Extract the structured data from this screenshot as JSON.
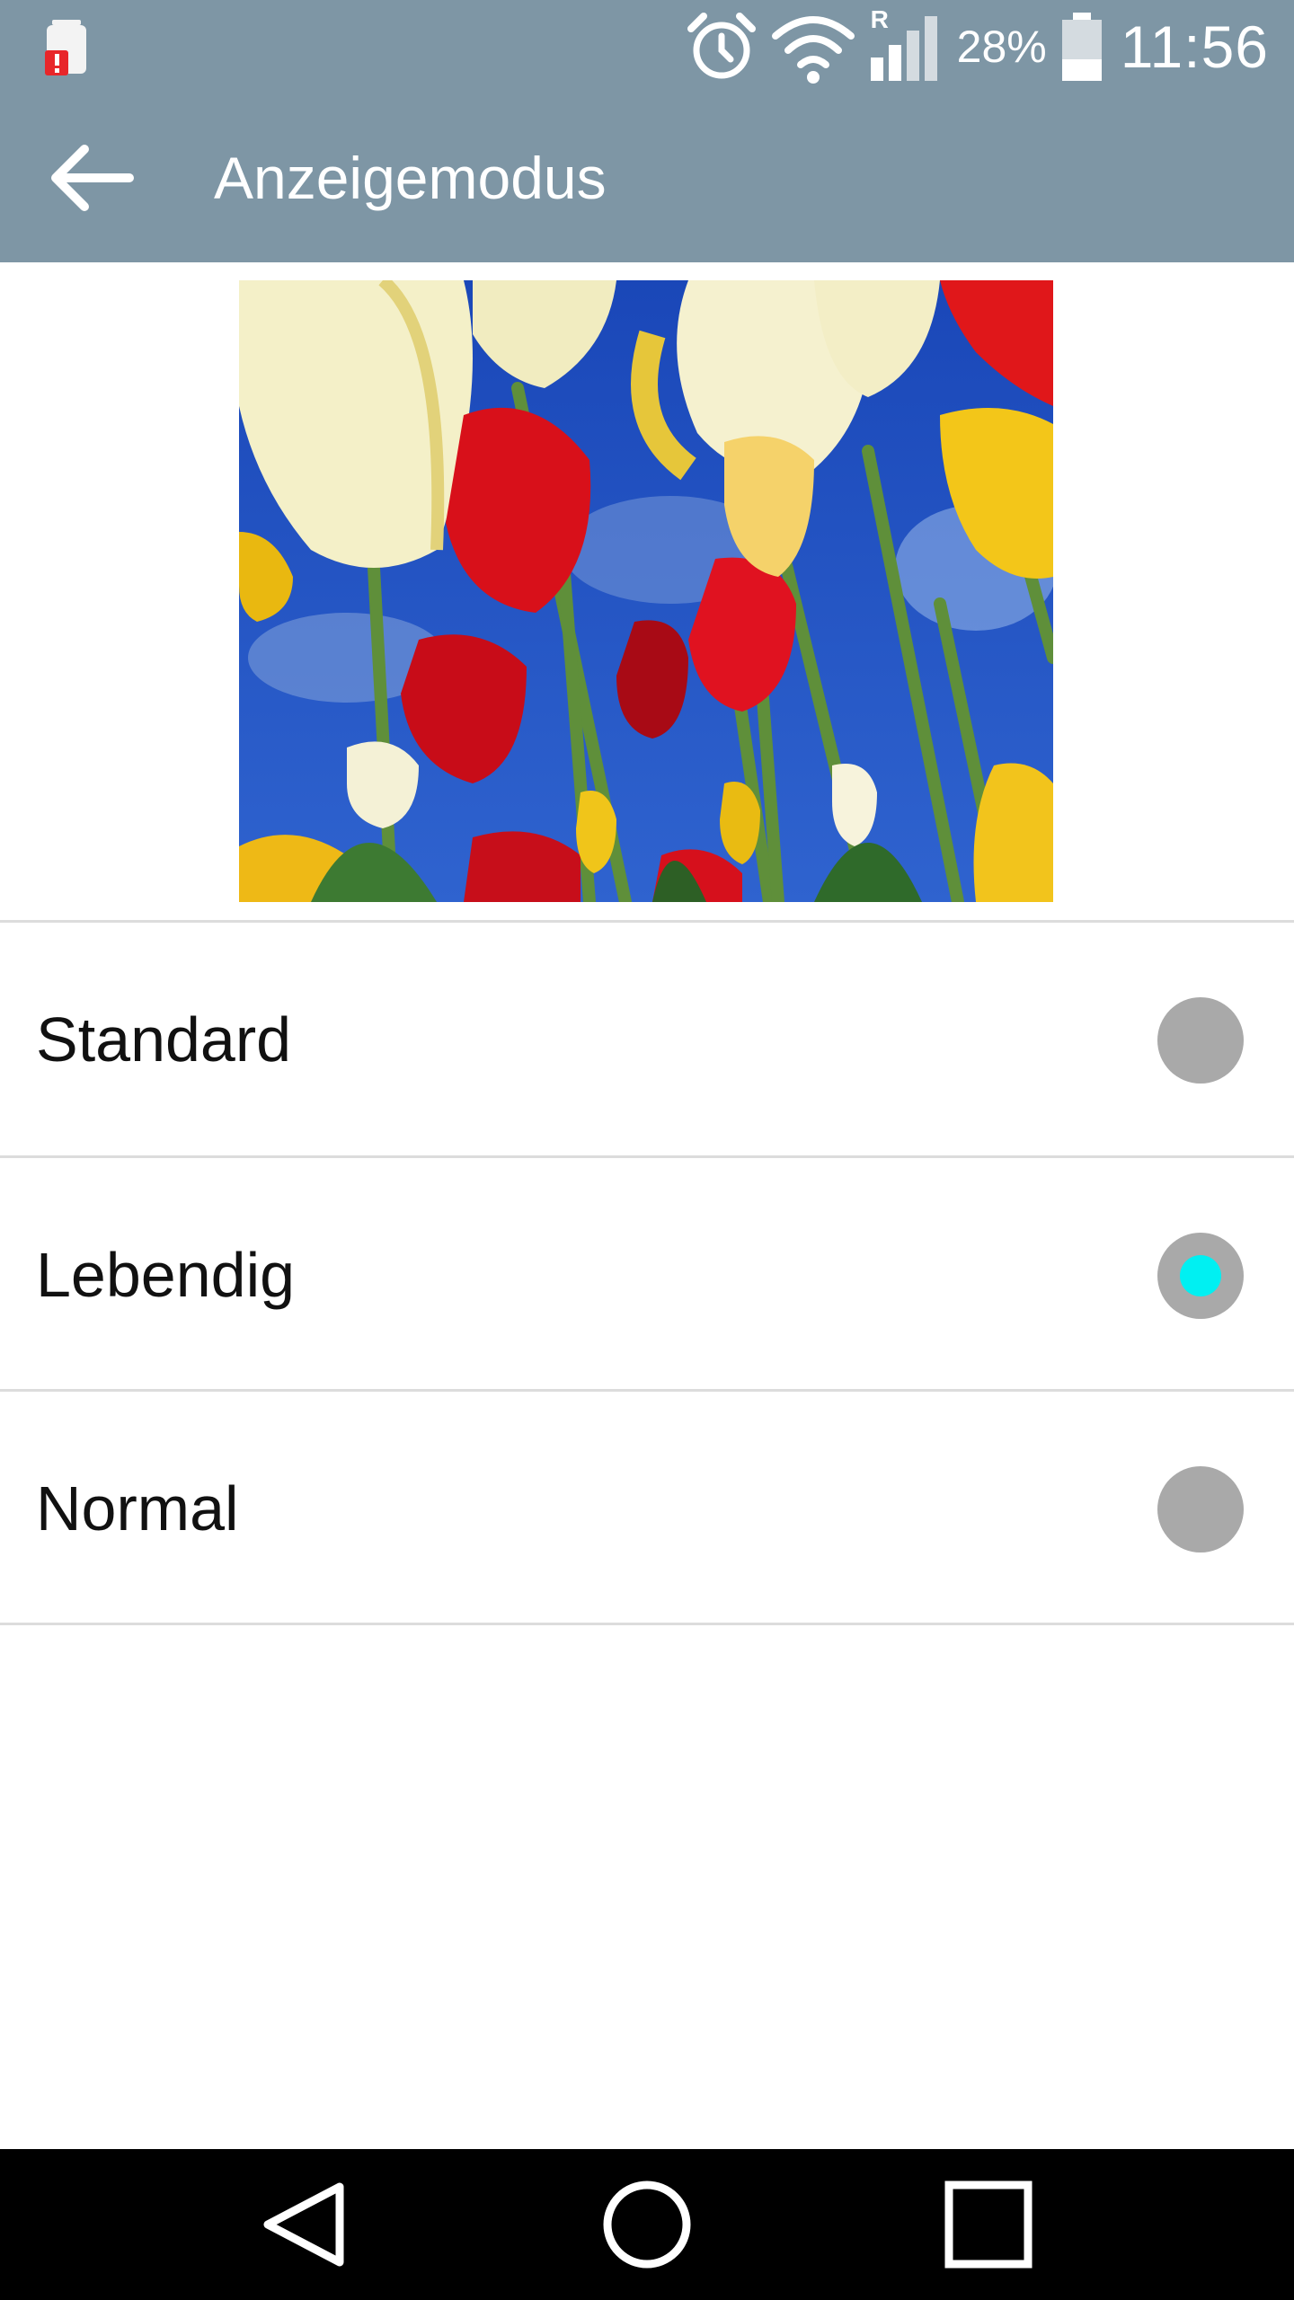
{
  "status_bar": {
    "battery_percent": "28%",
    "time": "11:56",
    "roaming_indicator": "R",
    "icons": [
      "battery-alert-icon",
      "alarm-icon",
      "wifi-icon",
      "signal-icon",
      "battery-icon"
    ],
    "background_color": "#7e96a5"
  },
  "action_bar": {
    "title": "Anzeigemodus",
    "back_icon": "arrow-left-icon"
  },
  "preview": {
    "subject": "tulips-photo"
  },
  "options": [
    {
      "label": "Standard",
      "selected": false
    },
    {
      "label": "Lebendig",
      "selected": true
    },
    {
      "label": "Normal",
      "selected": false
    }
  ],
  "colors": {
    "accent": "#00f0f2",
    "radio_inactive": "#a9a9a9"
  },
  "nav_bar": {
    "icons": [
      "back-triangle-icon",
      "home-circle-icon",
      "recents-square-icon"
    ]
  }
}
